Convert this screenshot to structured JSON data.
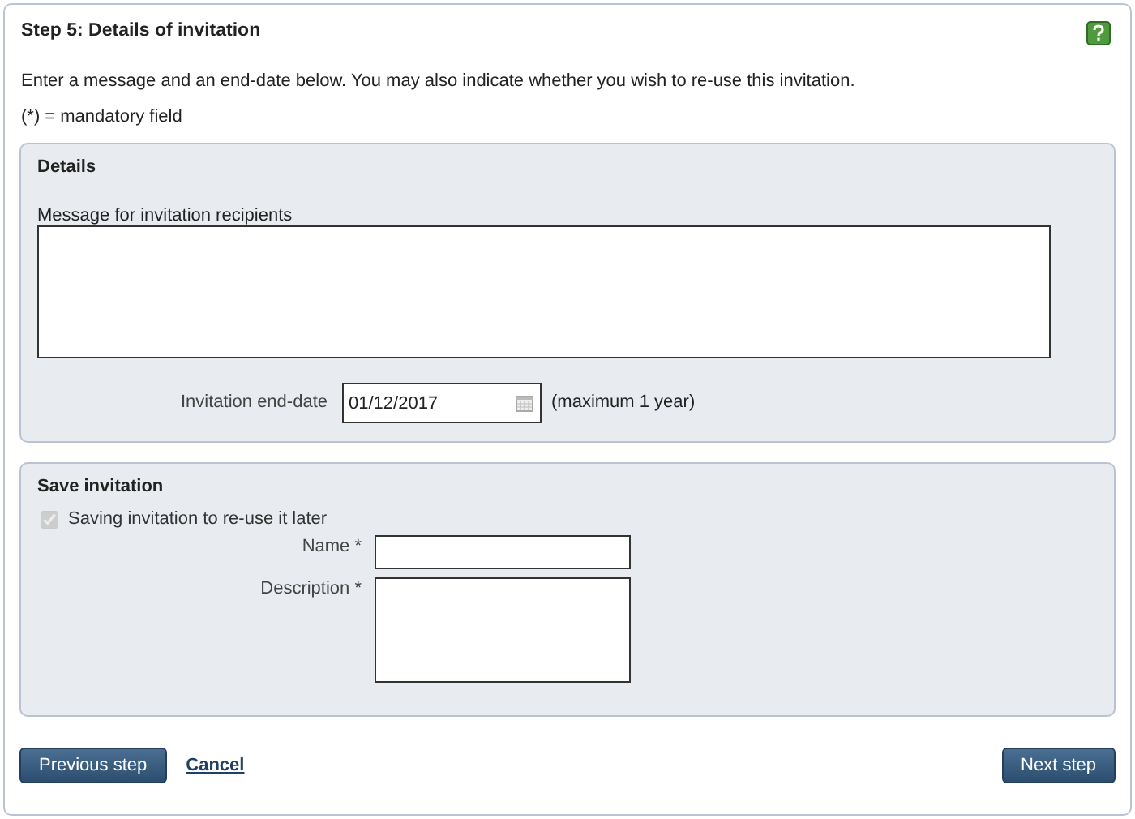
{
  "title": "Step 5: Details of invitation",
  "intro": "Enter a message and an end-date below. You may also indicate whether you wish to re-use this invitation.",
  "mandatory_note": "(*) = mandatory field",
  "details": {
    "heading": "Details",
    "message_label": "Message for invitation recipients",
    "end_date_label": "Invitation end-date",
    "end_date_value": "01/12/2017",
    "end_date_hint": "(maximum 1 year)"
  },
  "save": {
    "heading": "Save invitation",
    "reuse": {
      "label": "Saving invitation to re-use it later",
      "checked": true,
      "disabled": true
    },
    "name_label": "Name *",
    "description_label": "Description *"
  },
  "buttons": {
    "previous": "Previous step",
    "cancel": "Cancel",
    "next": "Next step"
  }
}
